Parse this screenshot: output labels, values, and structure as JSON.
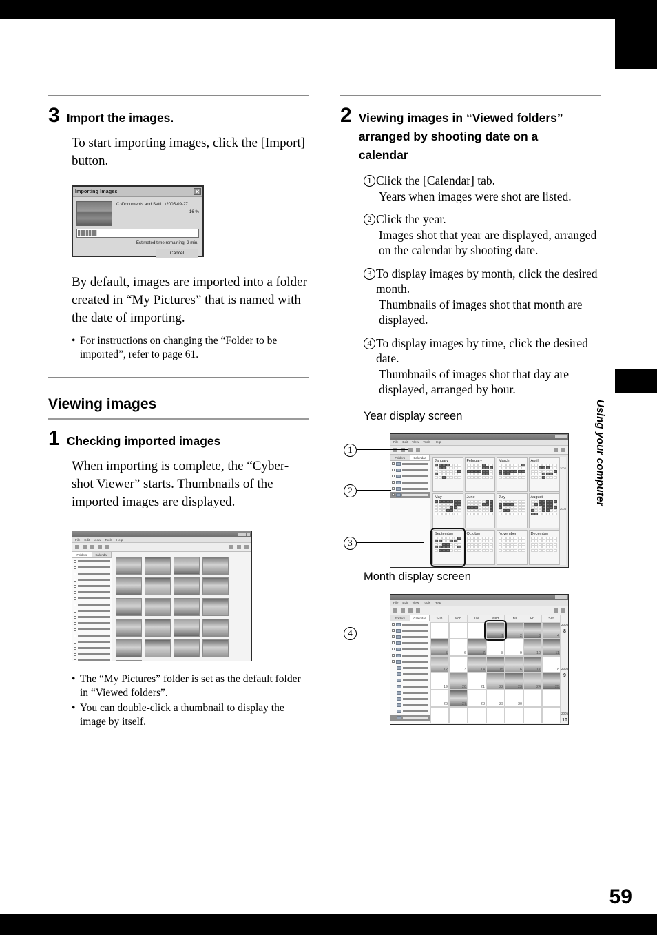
{
  "page": {
    "number": "59",
    "side_tab_label": "Using your computer"
  },
  "left_column": {
    "step3": {
      "number": "3",
      "title": "Import the images.",
      "body": "To start importing images, click the [Import] button.",
      "body2": "By default, images are imported into a folder created in “My Pictures” that is named with the date of importing.",
      "notes": [
        "For instructions on changing the “Folder to be imported”, refer to page 61."
      ]
    },
    "import_dialog": {
      "title": "Importing Images",
      "close_label": "✕",
      "path": "C:\\Documents and Setti...\\2005-09-27",
      "percent": "16 %",
      "progress_value": 16,
      "eta": "Estimated time remaining: 2 min.",
      "cancel_label": "Cancel"
    },
    "section": {
      "title": "Viewing images"
    },
    "step1": {
      "number": "1",
      "title": "Checking imported images",
      "body": "When importing is complete, the “Cyber-shot Viewer” starts. Thumbnails of the imported images are displayed.",
      "notes": [
        "The “My Pictures” folder is set as the default folder in “Viewed folders”.",
        "You can double-click a thumbnail to display the image by itself."
      ]
    },
    "viewer_window": {
      "menus": [
        "File",
        "Edit",
        "View",
        "Tools",
        "Help"
      ],
      "tabs": [
        "Folders",
        "Calendar"
      ],
      "selected_tab": "Folders",
      "folder_dates": [
        "2005-06-10",
        "2005-06-21",
        "2005-06-30",
        "2005-07-08",
        "2005-07-16",
        "2005-07-19",
        "2005-07-25",
        "2005-08-02",
        "2005-08-16",
        "2005-08-23",
        "2005-09-04",
        "2005-09-06",
        "2005-09-11",
        "2005-09-12",
        "2005-09-16",
        "2005-09-14",
        "2005-09-21",
        "2005-09-25",
        "2005-09-27",
        "2005-09-28",
        "2005-09-27"
      ],
      "selected_folder": "2005-09-27",
      "thumbnail_count": 21
    }
  },
  "right_column": {
    "step2": {
      "number": "2",
      "title": "Viewing images in “Viewed folders” arranged by shooting date on a calendar",
      "items": [
        {
          "num": "1",
          "main": "Click the [Calendar] tab.",
          "sub": "Years when images were shot are listed."
        },
        {
          "num": "2",
          "main": "Click the year.",
          "sub": "Images shot that year are displayed, arranged on the calendar by shooting date."
        },
        {
          "num": "3",
          "main": "To display images by month, click the desired month.",
          "sub": "Thumbnails of images shot that month are displayed."
        },
        {
          "num": "4",
          "main": "To display images by time, click the desired date.",
          "sub": "Thumbnails of images shot that day are displayed, arranged by hour."
        }
      ]
    },
    "year_figure": {
      "label": "Year display screen",
      "menus": [
        "File",
        "Edit",
        "View",
        "Tools",
        "Help"
      ],
      "tabs": [
        "Folders",
        "Calendar"
      ],
      "selected_tab": "Calendar",
      "years": [
        "1999",
        "2000",
        "2001",
        "2002",
        "2003",
        "2005"
      ],
      "year_counts": [
        "(42)",
        "(86)",
        "(69)",
        "(1082)",
        "(1445)",
        "(276)"
      ],
      "selected_year": "2005",
      "months": [
        "January",
        "February",
        "March",
        "April",
        "May",
        "June",
        "July",
        "August",
        "September",
        "October",
        "November",
        "December"
      ],
      "highlighted_month": "September",
      "scroll_years": [
        "2004",
        "2005"
      ],
      "callouts": [
        "1",
        "2",
        "3"
      ]
    },
    "month_figure": {
      "label": "Month display screen",
      "menus": [
        "File",
        "Edit",
        "View",
        "Tools",
        "Help"
      ],
      "tabs": [
        "Folders",
        "Calendar"
      ],
      "selected_tab": "Calendar",
      "day_headers": [
        "Sun",
        "Mon",
        "Tue",
        "Wed",
        "Thu",
        "Fri",
        "Sat"
      ],
      "tree_years": [
        "1999",
        "2000",
        "2001",
        "2002",
        "2003",
        "2004",
        "2005"
      ],
      "tree_year_counts": [
        "(42)",
        "(86)",
        "(69)",
        "(1082)",
        "(1445)",
        "(2046)",
        "(2734)"
      ],
      "tree_months": [
        "January",
        "February",
        "March",
        "April",
        "May",
        "June",
        "July",
        "August",
        "September"
      ],
      "tree_month_counts": [
        "(305)",
        "(311)",
        "(437)",
        "(222)",
        "(367)",
        "(440)",
        "(166)",
        "(305)",
        "(99)"
      ],
      "selected_month": "September",
      "days": [
        "",
        "",
        "",
        "1",
        "2",
        "3",
        "4",
        "5",
        "6",
        "7",
        "8",
        "9",
        "10",
        "11",
        "12",
        "13",
        "14",
        "15",
        "16",
        "17",
        "18",
        "19",
        "20",
        "21",
        "22",
        "23",
        "24",
        "25",
        "26",
        "27",
        "28",
        "29",
        "30"
      ],
      "highlighted_day": "1",
      "scroll_markers": [
        "2005 8",
        "2005 9",
        "2005 10"
      ],
      "callouts": [
        "4"
      ]
    }
  }
}
